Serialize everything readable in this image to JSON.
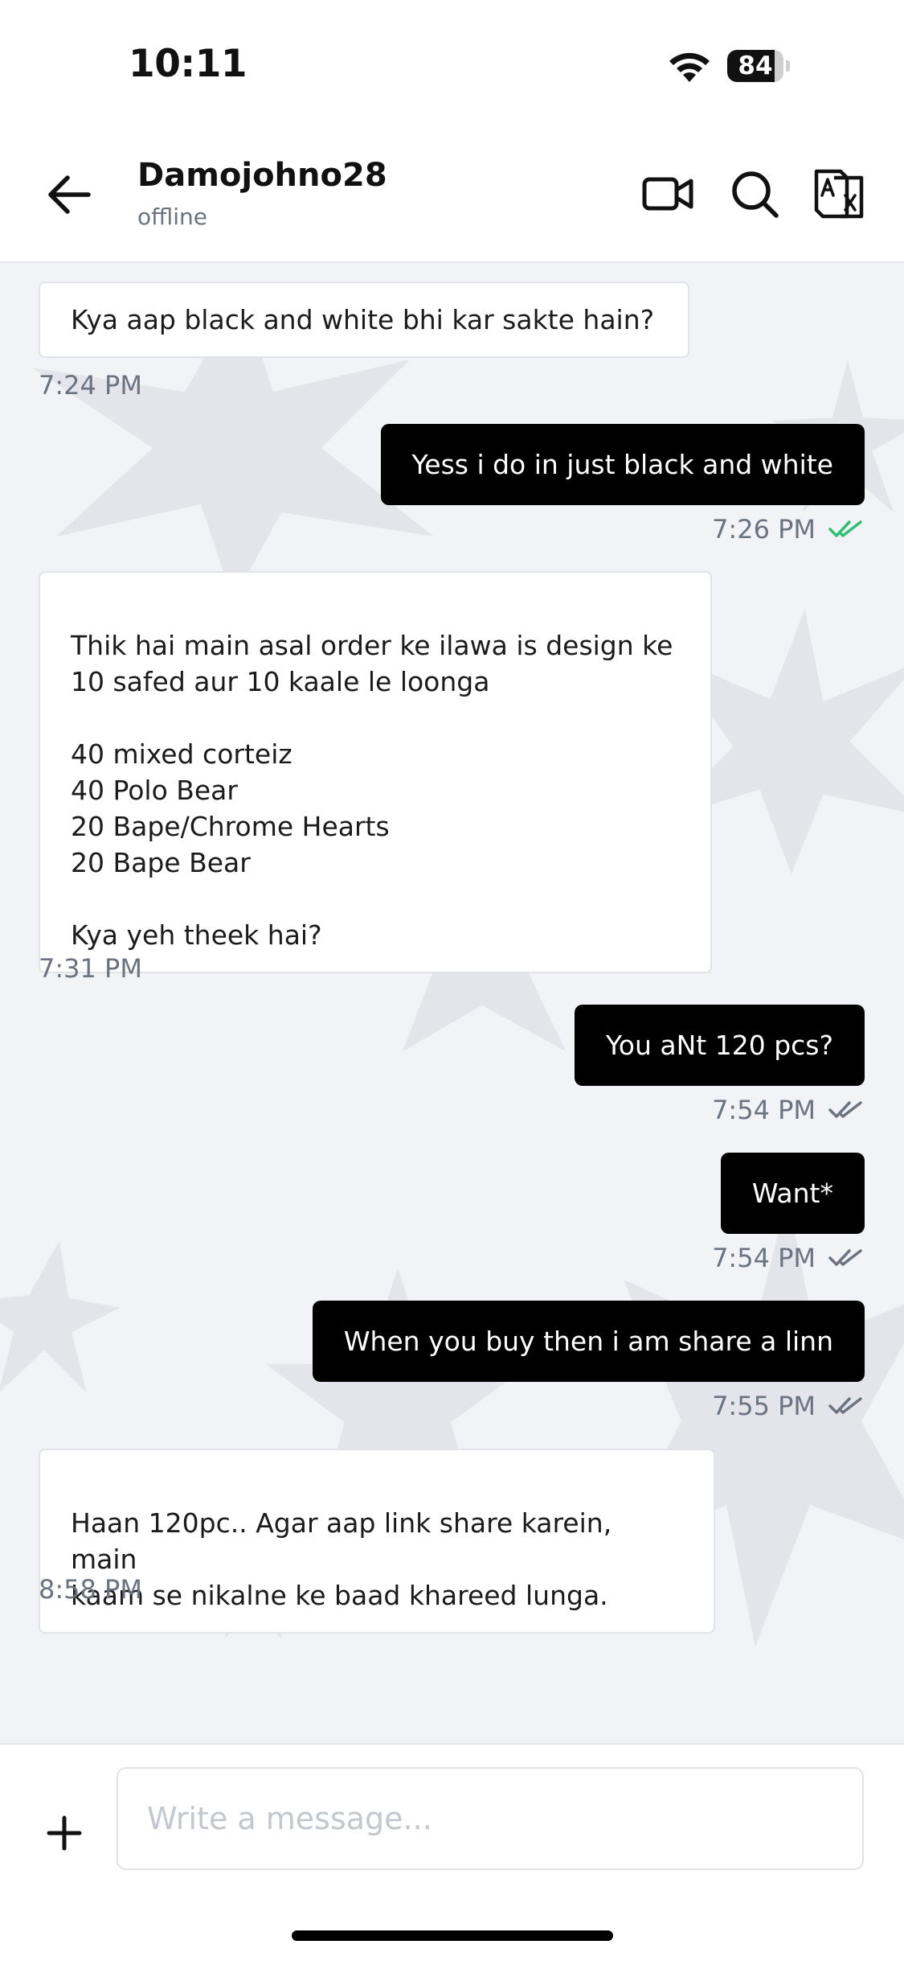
{
  "status_bar": {
    "time": "10:11",
    "battery_level": "84",
    "battery_fraction": 0.84
  },
  "header": {
    "contact_name": "Damojohno28",
    "contact_status": "offline",
    "icons": [
      "back-arrow-icon",
      "video-call-icon",
      "search-icon",
      "translate-icon"
    ]
  },
  "messages": [
    {
      "direction": "in",
      "text": "Kya aap black and white bhi kar sakte hain?",
      "time": "7:24 PM"
    },
    {
      "direction": "out",
      "text": "Yess i do in just black and white",
      "time": "7:26 PM",
      "receipt": "read"
    },
    {
      "direction": "in",
      "text": "Thik hai main asal order ke ilawa is design ke\n10 safed aur 10 kaale le loonga\n\n40 mixed corteiz\n40 Polo Bear\n20 Bape/Chrome Hearts\n20 Bape Bear\n\nKya yeh theek hai?",
      "time": "7:31 PM"
    },
    {
      "direction": "out",
      "text": "You aNt 120 pcs?",
      "time": "7:54 PM",
      "receipt": "delivered"
    },
    {
      "direction": "out",
      "text": "Want*",
      "time": "7:54 PM",
      "receipt": "delivered"
    },
    {
      "direction": "out",
      "text": "When you buy then i am share a linn",
      "time": "7:55 PM",
      "receipt": "delivered"
    },
    {
      "direction": "in",
      "text": "Haan 120pc.. Agar aap link share karein, main\nkaam se nikalne ke baad khareed lunga.",
      "time": "8:58 PM"
    }
  ],
  "composer": {
    "placeholder": "Write a message..."
  },
  "colors": {
    "read_check": "#2fbf71",
    "delivered_check": "#6b7380",
    "outgoing_bubble": "#000000",
    "chat_background": "#f2f3f6"
  }
}
